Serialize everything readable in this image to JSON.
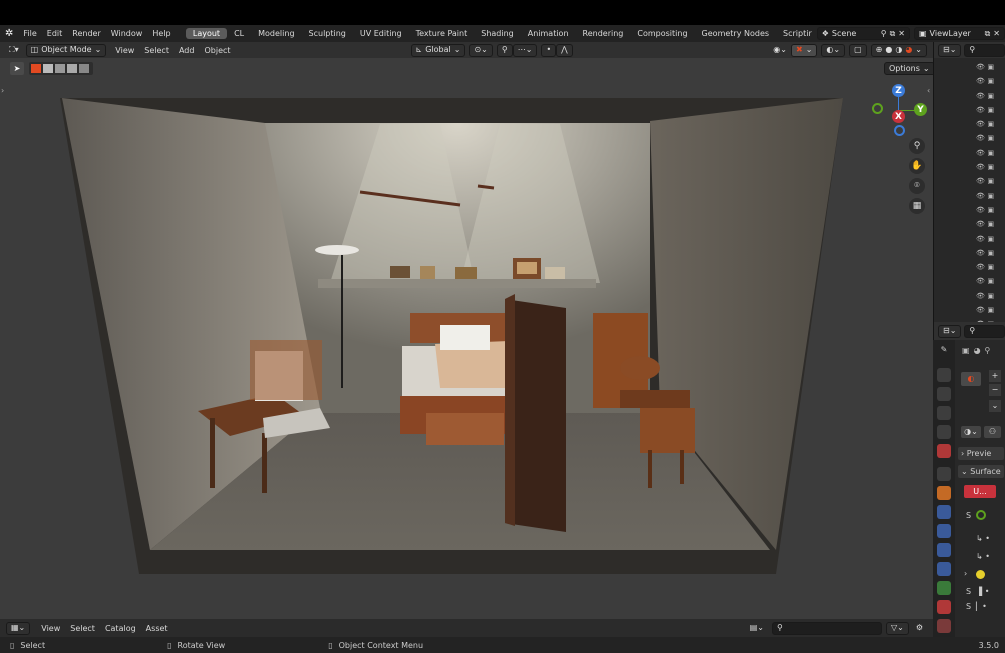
{
  "menu": [
    "File",
    "Edit",
    "Render",
    "Window",
    "Help"
  ],
  "workspaces": [
    "Layout",
    "CL",
    "Modeling",
    "Sculpting",
    "UV Editing",
    "Texture Paint",
    "Shading",
    "Animation",
    "Rendering",
    "Compositing",
    "Geometry Nodes",
    "Scriptir"
  ],
  "active_workspace": "Layout",
  "scene_name": "Scene",
  "view_layer": "ViewLayer",
  "viewport_header": {
    "mode": "Object Mode",
    "menus": [
      "View",
      "Select",
      "Add",
      "Object"
    ],
    "orientation": "Global",
    "options": "Options"
  },
  "gizmo": {
    "z": "Z",
    "x": "X",
    "y": "Y"
  },
  "footer_menus": [
    "View",
    "Select",
    "Catalog",
    "Asset"
  ],
  "status": {
    "select": "Select",
    "rotate": "Rotate View",
    "context": "Object Context Menu",
    "version": "3.5.0"
  },
  "properties": {
    "preview": "Previe",
    "surface": "Surface",
    "material_short": "U...",
    "s1": "S",
    "s2": "S",
    "s3": "S"
  },
  "colors": {
    "accent": "#e24a22",
    "active_ws": "#5b5b5b",
    "header": "#303030",
    "viewport": "#3c3c3c"
  }
}
